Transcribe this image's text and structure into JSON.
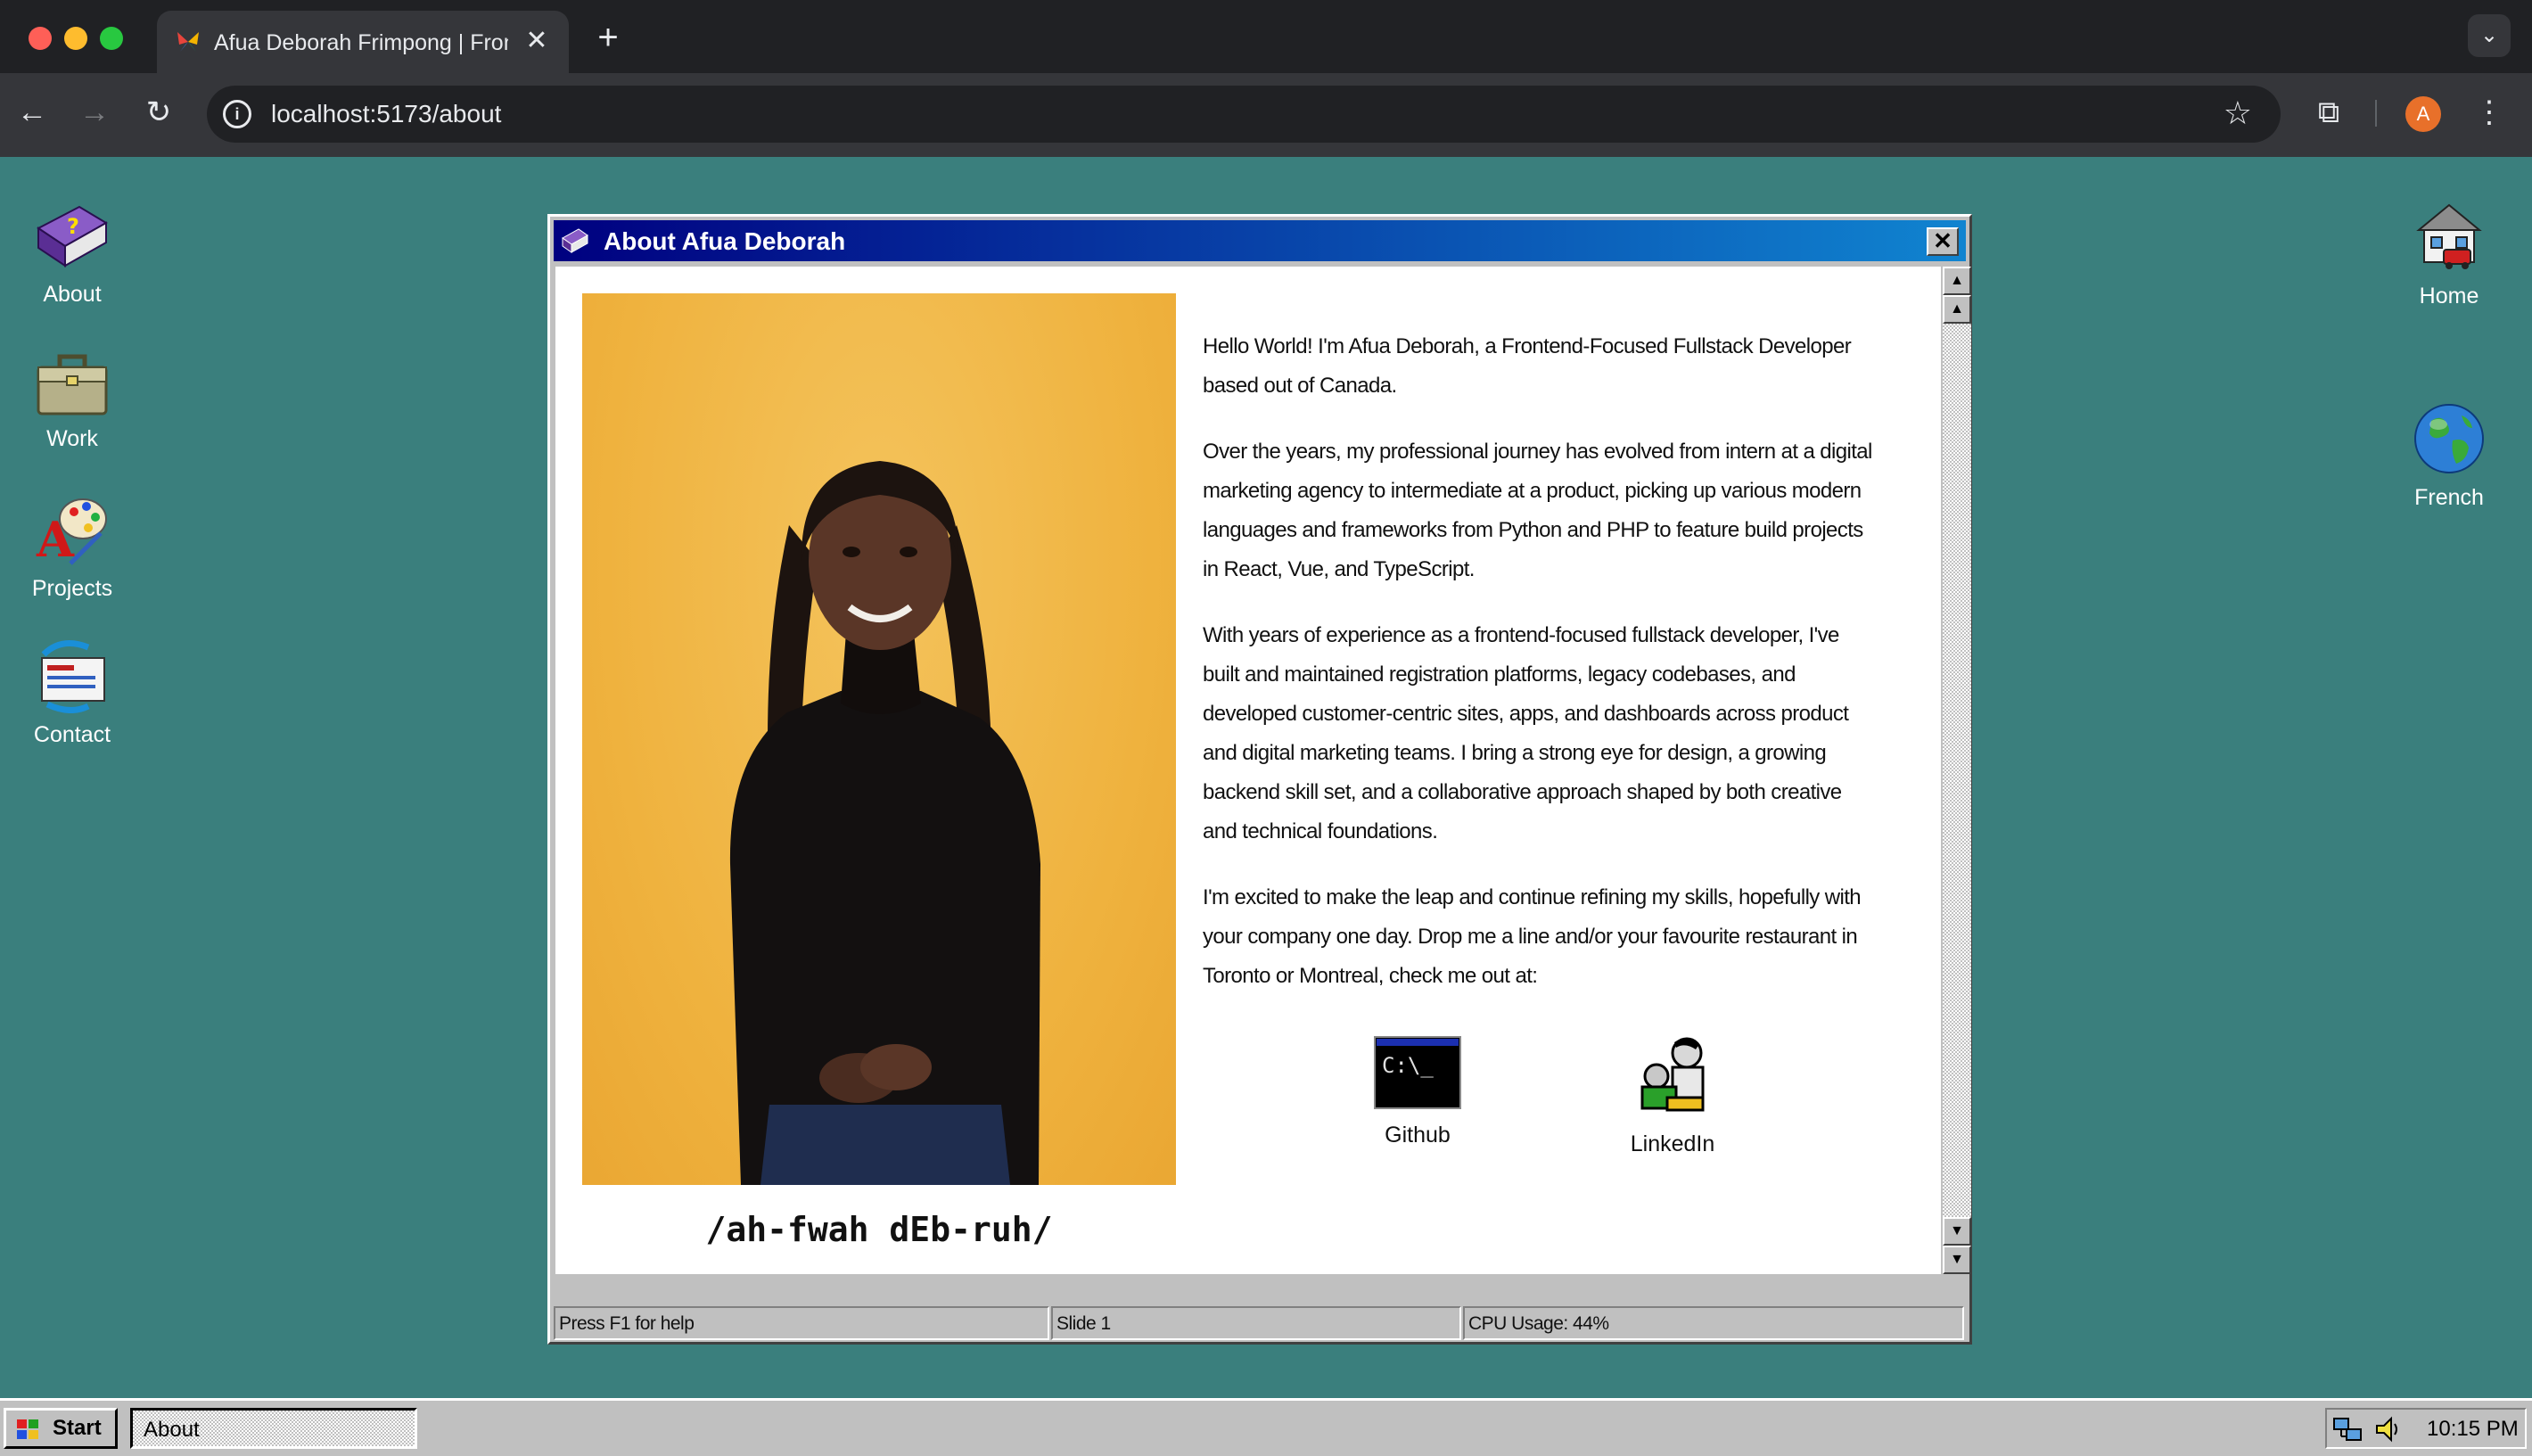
{
  "browser": {
    "tab_title": "Afua Deborah Frimpong | Frontend Developer",
    "tab_close": "✕",
    "new_tab": "+",
    "url": "localhost:5173/about",
    "profile_initial": "A",
    "icons": [
      "back-icon",
      "forward-icon",
      "reload-icon",
      "info-icon",
      "star-icon",
      "extensions-icon",
      "menu-icon"
    ]
  },
  "desktop": {
    "left_icons": [
      {
        "label": "About",
        "icon": "help-book-icon"
      },
      {
        "label": "Work",
        "icon": "briefcase-icon"
      },
      {
        "label": "Projects",
        "icon": "paint-icon"
      },
      {
        "label": "Contact",
        "icon": "mail-icon"
      }
    ],
    "right_icons": [
      {
        "label": "Home",
        "icon": "house-icon"
      },
      {
        "label": "French",
        "icon": "globe-icon"
      }
    ]
  },
  "window": {
    "title": "About Afua Deborah",
    "close_label": "✕",
    "phonetic": "/ah-fwah dEb-ruh/",
    "bio": [
      "Hello World! I'm Afua Deborah, a Frontend-Focused Fullstack Developer based out of Canada.",
      "Over the years, my professional journey has evolved from intern at a digital marketing agency to intermediate at a product, picking up various modern languages and frameworks from Python and PHP to feature build projects in React, Vue, and TypeScript.",
      "With years of experience as a frontend-focused fullstack developer, I've built and maintained registration platforms, legacy codebases, and developed customer-centric sites, apps, and dashboards across product and digital marketing teams. I bring a strong eye for design, a growing backend skill set, and a collaborative approach shaped by both creative and technical foundations.",
      "I'm excited to make the leap and continue refining my skills, hopefully with your company one day. Drop me a line and/or your favourite restaurant in Toronto or Montreal, check me out at:"
    ],
    "links": [
      {
        "label": "Github",
        "icon": "terminal-icon"
      },
      {
        "label": "LinkedIn",
        "icon": "people-icon"
      }
    ],
    "terminal_text": "C:\\_",
    "status": {
      "help": "Press F1 for help",
      "slide": "Slide 1",
      "cpu": "CPU Usage: 44%"
    }
  },
  "taskbar": {
    "start_label": "Start",
    "task_label": "About",
    "clock": "10:15 PM"
  },
  "colors": {
    "desktop": "#3a7f7d",
    "title_gradient_start": "#000080",
    "title_gradient_end": "#1084d0",
    "photo_background": "#efb23e"
  }
}
